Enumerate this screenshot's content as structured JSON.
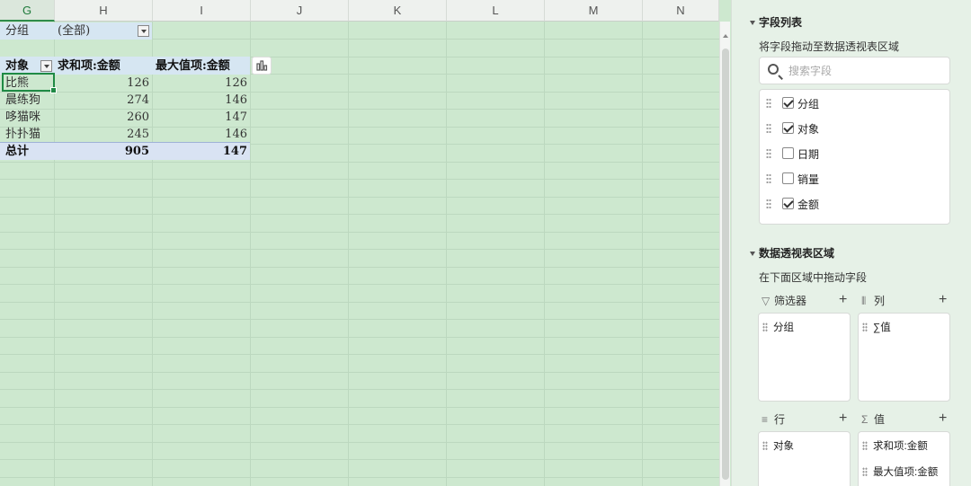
{
  "columns": [
    "G",
    "H",
    "I",
    "J",
    "K",
    "L",
    "M",
    "N"
  ],
  "selected_column": "G",
  "filter_row": {
    "field": "分组",
    "value": "(全部)"
  },
  "pivot": {
    "headers": [
      "对象",
      "求和项:金额",
      "最大值项:金额"
    ],
    "rows": [
      {
        "name": "比熊",
        "sum": "126",
        "max": "126"
      },
      {
        "name": "晨练狗",
        "sum": "274",
        "max": "146"
      },
      {
        "name": "哆猫咪",
        "sum": "260",
        "max": "147"
      },
      {
        "name": "扑扑猫",
        "sum": "245",
        "max": "146"
      }
    ],
    "total": {
      "name": "总计",
      "sum": "905",
      "max": "147"
    }
  },
  "panel": {
    "field_list_title": "字段列表",
    "field_list_hint": "将字段拖动至数据透视表区域",
    "search_placeholder": "搜索字段",
    "fields": [
      {
        "label": "分组",
        "checked": true
      },
      {
        "label": "对象",
        "checked": true
      },
      {
        "label": "日期",
        "checked": false
      },
      {
        "label": "销量",
        "checked": false
      },
      {
        "label": "金额",
        "checked": true
      }
    ],
    "areas_title": "数据透视表区域",
    "areas_hint": "在下面区域中拖动字段",
    "filter_label": "筛选器",
    "columns_label": "列",
    "rows_label": "行",
    "values_label": "值",
    "filter_items": [
      "分组"
    ],
    "column_items": [
      "∑值"
    ],
    "row_items": [
      "对象"
    ],
    "value_items": [
      "求和项:金额",
      "最大值项:金额"
    ]
  },
  "colors": {
    "sheet_bg": "#cde8cf",
    "accent": "#1f8a45",
    "header_bg": "#d6e6f2"
  }
}
